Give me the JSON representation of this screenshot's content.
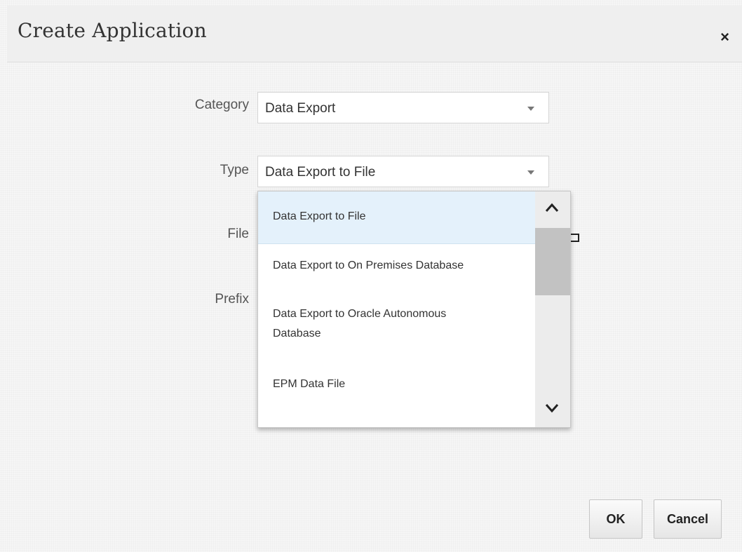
{
  "dialog": {
    "title": "Create Application",
    "close_label": "×"
  },
  "form": {
    "category_label": "Category",
    "category_value": "Data Export",
    "type_label": "Type",
    "type_value": "Data Export to File",
    "file_label": "File",
    "prefix_label": "Prefix"
  },
  "dropdown": {
    "options": [
      "Data Export to File",
      "Data Export to On Premises Database",
      "Data Export to Oracle Autonomous",
      "Database",
      "EPM Data File"
    ],
    "selected_index": 0
  },
  "buttons": {
    "ok_label": "OK",
    "cancel_label": "Cancel"
  },
  "icons": {
    "close": "close-icon",
    "caret": "caret-down-icon",
    "scroll_up": "chevron-up-icon",
    "scroll_down": "chevron-down-icon",
    "folder": "folder-icon"
  },
  "colors": {
    "selected_option_bg": "#e4f1fb",
    "dialog_bg": "#f6f6f6",
    "scroll_thumb": "#c2c2c2"
  }
}
